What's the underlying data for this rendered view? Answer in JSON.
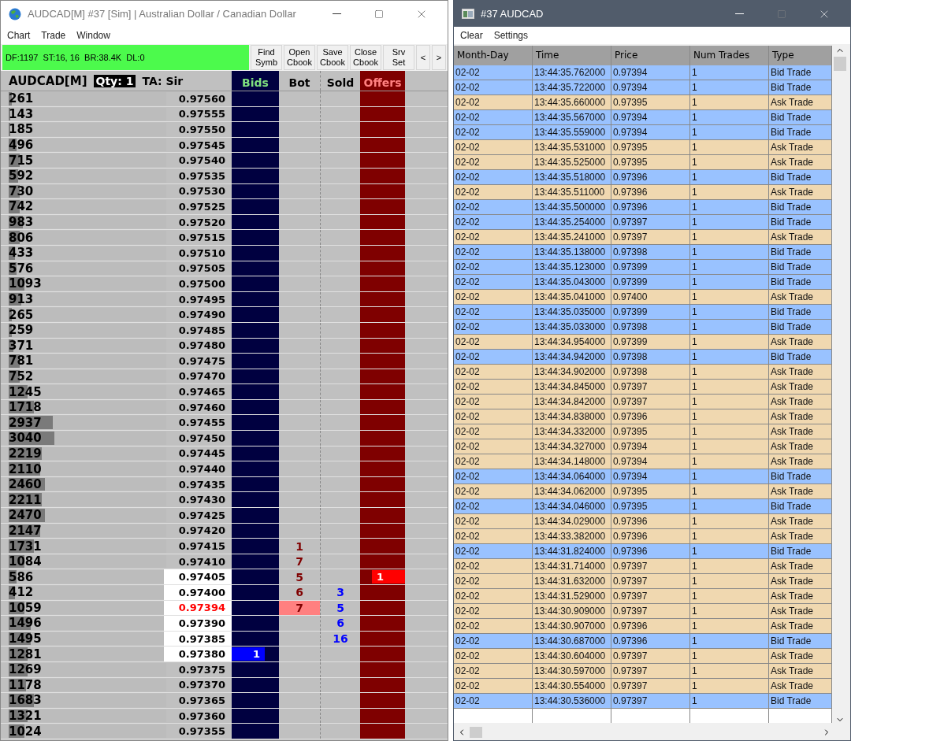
{
  "dom_window": {
    "title": "AUDCAD[M]  #37 [Sim]  | Australian Dollar / Canadian Dollar",
    "menu": [
      "Chart",
      "Trade",
      "Window"
    ],
    "status": "DF:1197  ST:16, 16  BR:38.4K  DL:0",
    "buttons": [
      {
        "lines": [
          "Find",
          "Symb"
        ]
      },
      {
        "lines": [
          "Open",
          "Cbook"
        ]
      },
      {
        "lines": [
          "Save",
          "Cbook"
        ]
      },
      {
        "lines": [
          "Close",
          "Cbook"
        ]
      },
      {
        "lines": [
          "Srv",
          "Set"
        ]
      }
    ],
    "nav_buttons": [
      "<",
      ">"
    ],
    "symbol": "AUDCAD[M]",
    "qty": "Qty: 1",
    "ta": "TA: Sir",
    "columns": {
      "bids": "Bids",
      "bot": "Bot",
      "sold": "Sold",
      "offers": "Offers"
    },
    "rows": [
      {
        "volume": "261",
        "price": "0.97560",
        "level": 0.02
      },
      {
        "volume": "143",
        "price": "0.97555",
        "level": 0.01
      },
      {
        "volume": "185",
        "price": "0.97550",
        "level": 0.01
      },
      {
        "volume": "496",
        "price": "0.97545",
        "level": 0.05
      },
      {
        "volume": "715",
        "price": "0.97540",
        "level": 0.07
      },
      {
        "volume": "592",
        "price": "0.97535",
        "level": 0.06
      },
      {
        "volume": "730",
        "price": "0.97530",
        "level": 0.07
      },
      {
        "volume": "742",
        "price": "0.97525",
        "level": 0.07
      },
      {
        "volume": "983",
        "price": "0.97520",
        "level": 0.09
      },
      {
        "volume": "806",
        "price": "0.97515",
        "level": 0.07
      },
      {
        "volume": "433",
        "price": "0.97510",
        "level": 0.04
      },
      {
        "volume": "576",
        "price": "0.97505",
        "level": 0.05
      },
      {
        "volume": "1093",
        "price": "0.97500",
        "level": 0.1
      },
      {
        "volume": "913",
        "price": "0.97495",
        "level": 0.08
      },
      {
        "volume": "265",
        "price": "0.97490",
        "level": 0.02
      },
      {
        "volume": "259",
        "price": "0.97485",
        "level": 0.02
      },
      {
        "volume": "371",
        "price": "0.97480",
        "level": 0.03
      },
      {
        "volume": "781",
        "price": "0.97475",
        "level": 0.07
      },
      {
        "volume": "752",
        "price": "0.97470",
        "level": 0.07
      },
      {
        "volume": "1245",
        "price": "0.97465",
        "level": 0.12
      },
      {
        "volume": "1718",
        "price": "0.97460",
        "level": 0.16
      },
      {
        "volume": "2937",
        "price": "0.97455",
        "level": 0.28
      },
      {
        "volume": "3040",
        "price": "0.97450",
        "level": 0.29
      },
      {
        "volume": "2219",
        "price": "0.97445",
        "level": 0.21
      },
      {
        "volume": "2110",
        "price": "0.97440",
        "level": 0.2
      },
      {
        "volume": "2460",
        "price": "0.97435",
        "level": 0.23
      },
      {
        "volume": "2211",
        "price": "0.97430",
        "level": 0.21
      },
      {
        "volume": "2470",
        "price": "0.97425",
        "level": 0.23
      },
      {
        "volume": "2147",
        "price": "0.97420",
        "level": 0.2
      },
      {
        "volume": "1731",
        "price": "0.97415",
        "level": 0.16,
        "bot": "1"
      },
      {
        "volume": "1084",
        "price": "0.97410",
        "level": 0.1,
        "bot": "7"
      },
      {
        "volume": "586",
        "price": "0.97405",
        "level": 0.05,
        "bot": "5",
        "price_highlight": true,
        "offer_order": "1"
      },
      {
        "volume": "412",
        "price": "0.97400",
        "level": 0.04,
        "bot": "6",
        "sold": "3",
        "price_highlight": true
      },
      {
        "volume": "1059",
        "price": "0.97394",
        "level": 0.1,
        "bot": "7",
        "bot_highlight": true,
        "sold": "5",
        "price_highlight": true,
        "last": true
      },
      {
        "volume": "1496",
        "price": "0.97390",
        "level": 0.14,
        "sold": "6",
        "price_highlight": true
      },
      {
        "volume": "1495",
        "price": "0.97385",
        "level": 0.14,
        "sold": "16",
        "price_highlight": true
      },
      {
        "volume": "1281",
        "price": "0.97380",
        "level": 0.12,
        "price_highlight": true,
        "bid_order": "1"
      },
      {
        "volume": "1269",
        "price": "0.97375",
        "level": 0.12
      },
      {
        "volume": "1178",
        "price": "0.97370",
        "level": 0.11
      },
      {
        "volume": "1683",
        "price": "0.97365",
        "level": 0.16
      },
      {
        "volume": "1321",
        "price": "0.97360",
        "level": 0.12
      },
      {
        "volume": "1024",
        "price": "0.97355",
        "level": 0.1
      }
    ]
  },
  "tape_window": {
    "title": "#37 AUDCAD",
    "menu": [
      "Clear",
      "Settings"
    ],
    "columns": [
      "Month-Day",
      "Time",
      "Price",
      "Num Trades",
      "Type"
    ],
    "rows": [
      {
        "kind": "bid",
        "date": "02-02",
        "time": "13:44:35.762000",
        "price": "0.97394",
        "trades": "1",
        "type": "Bid Trade"
      },
      {
        "kind": "bid",
        "date": "02-02",
        "time": "13:44:35.722000",
        "price": "0.97394",
        "trades": "1",
        "type": "Bid Trade"
      },
      {
        "kind": "ask",
        "date": "02-02",
        "time": "13:44:35.660000",
        "price": "0.97395",
        "trades": "1",
        "type": "Ask Trade"
      },
      {
        "kind": "bid",
        "date": "02-02",
        "time": "13:44:35.567000",
        "price": "0.97394",
        "trades": "1",
        "type": "Bid Trade"
      },
      {
        "kind": "bid",
        "date": "02-02",
        "time": "13:44:35.559000",
        "price": "0.97394",
        "trades": "1",
        "type": "Bid Trade"
      },
      {
        "kind": "ask",
        "date": "02-02",
        "time": "13:44:35.531000",
        "price": "0.97395",
        "trades": "1",
        "type": "Ask Trade"
      },
      {
        "kind": "ask",
        "date": "02-02",
        "time": "13:44:35.525000",
        "price": "0.97395",
        "trades": "1",
        "type": "Ask Trade"
      },
      {
        "kind": "bid",
        "date": "02-02",
        "time": "13:44:35.518000",
        "price": "0.97396",
        "trades": "1",
        "type": "Bid Trade"
      },
      {
        "kind": "ask",
        "date": "02-02",
        "time": "13:44:35.511000",
        "price": "0.97396",
        "trades": "1",
        "type": "Ask Trade"
      },
      {
        "kind": "bid",
        "date": "02-02",
        "time": "13:44:35.500000",
        "price": "0.97396",
        "trades": "1",
        "type": "Bid Trade"
      },
      {
        "kind": "bid",
        "date": "02-02",
        "time": "13:44:35.254000",
        "price": "0.97397",
        "trades": "1",
        "type": "Bid Trade"
      },
      {
        "kind": "ask",
        "date": "02-02",
        "time": "13:44:35.241000",
        "price": "0.97397",
        "trades": "1",
        "type": "Ask Trade"
      },
      {
        "kind": "bid",
        "date": "02-02",
        "time": "13:44:35.138000",
        "price": "0.97398",
        "trades": "1",
        "type": "Bid Trade"
      },
      {
        "kind": "bid",
        "date": "02-02",
        "time": "13:44:35.123000",
        "price": "0.97399",
        "trades": "1",
        "type": "Bid Trade"
      },
      {
        "kind": "bid",
        "date": "02-02",
        "time": "13:44:35.043000",
        "price": "0.97399",
        "trades": "1",
        "type": "Bid Trade"
      },
      {
        "kind": "ask",
        "date": "02-02",
        "time": "13:44:35.041000",
        "price": "0.97400",
        "trades": "1",
        "type": "Ask Trade"
      },
      {
        "kind": "bid",
        "date": "02-02",
        "time": "13:44:35.035000",
        "price": "0.97399",
        "trades": "1",
        "type": "Bid Trade"
      },
      {
        "kind": "bid",
        "date": "02-02",
        "time": "13:44:35.033000",
        "price": "0.97398",
        "trades": "1",
        "type": "Bid Trade"
      },
      {
        "kind": "ask",
        "date": "02-02",
        "time": "13:44:34.954000",
        "price": "0.97399",
        "trades": "1",
        "type": "Ask Trade"
      },
      {
        "kind": "bid",
        "date": "02-02",
        "time": "13:44:34.942000",
        "price": "0.97398",
        "trades": "1",
        "type": "Bid Trade"
      },
      {
        "kind": "ask",
        "date": "02-02",
        "time": "13:44:34.902000",
        "price": "0.97398",
        "trades": "1",
        "type": "Ask Trade"
      },
      {
        "kind": "ask",
        "date": "02-02",
        "time": "13:44:34.845000",
        "price": "0.97397",
        "trades": "1",
        "type": "Ask Trade"
      },
      {
        "kind": "ask",
        "date": "02-02",
        "time": "13:44:34.842000",
        "price": "0.97397",
        "trades": "1",
        "type": "Ask Trade"
      },
      {
        "kind": "ask",
        "date": "02-02",
        "time": "13:44:34.838000",
        "price": "0.97396",
        "trades": "1",
        "type": "Ask Trade"
      },
      {
        "kind": "ask",
        "date": "02-02",
        "time": "13:44:34.332000",
        "price": "0.97395",
        "trades": "1",
        "type": "Ask Trade"
      },
      {
        "kind": "ask",
        "date": "02-02",
        "time": "13:44:34.327000",
        "price": "0.97394",
        "trades": "1",
        "type": "Ask Trade"
      },
      {
        "kind": "ask",
        "date": "02-02",
        "time": "13:44:34.148000",
        "price": "0.97394",
        "trades": "1",
        "type": "Ask Trade"
      },
      {
        "kind": "bid",
        "date": "02-02",
        "time": "13:44:34.064000",
        "price": "0.97394",
        "trades": "1",
        "type": "Bid Trade"
      },
      {
        "kind": "ask",
        "date": "02-02",
        "time": "13:44:34.062000",
        "price": "0.97395",
        "trades": "1",
        "type": "Ask Trade"
      },
      {
        "kind": "bid",
        "date": "02-02",
        "time": "13:44:34.046000",
        "price": "0.97395",
        "trades": "1",
        "type": "Bid Trade"
      },
      {
        "kind": "ask",
        "date": "02-02",
        "time": "13:44:34.029000",
        "price": "0.97396",
        "trades": "1",
        "type": "Ask Trade"
      },
      {
        "kind": "ask",
        "date": "02-02",
        "time": "13:44:33.382000",
        "price": "0.97396",
        "trades": "1",
        "type": "Ask Trade"
      },
      {
        "kind": "bid",
        "date": "02-02",
        "time": "13:44:31.824000",
        "price": "0.97396",
        "trades": "1",
        "type": "Bid Trade"
      },
      {
        "kind": "ask",
        "date": "02-02",
        "time": "13:44:31.714000",
        "price": "0.97397",
        "trades": "1",
        "type": "Ask Trade"
      },
      {
        "kind": "ask",
        "date": "02-02",
        "time": "13:44:31.632000",
        "price": "0.97397",
        "trades": "1",
        "type": "Ask Trade"
      },
      {
        "kind": "ask",
        "date": "02-02",
        "time": "13:44:31.529000",
        "price": "0.97397",
        "trades": "1",
        "type": "Ask Trade"
      },
      {
        "kind": "ask",
        "date": "02-02",
        "time": "13:44:30.909000",
        "price": "0.97397",
        "trades": "1",
        "type": "Ask Trade"
      },
      {
        "kind": "ask",
        "date": "02-02",
        "time": "13:44:30.907000",
        "price": "0.97396",
        "trades": "1",
        "type": "Ask Trade"
      },
      {
        "kind": "bid",
        "date": "02-02",
        "time": "13:44:30.687000",
        "price": "0.97396",
        "trades": "1",
        "type": "Bid Trade"
      },
      {
        "kind": "ask",
        "date": "02-02",
        "time": "13:44:30.604000",
        "price": "0.97397",
        "trades": "1",
        "type": "Ask Trade"
      },
      {
        "kind": "ask",
        "date": "02-02",
        "time": "13:44:30.597000",
        "price": "0.97397",
        "trades": "1",
        "type": "Ask Trade"
      },
      {
        "kind": "ask",
        "date": "02-02",
        "time": "13:44:30.554000",
        "price": "0.97397",
        "trades": "1",
        "type": "Ask Trade"
      },
      {
        "kind": "bid",
        "date": "02-02",
        "time": "13:44:30.536000",
        "price": "0.97397",
        "trades": "1",
        "type": "Bid Trade"
      }
    ]
  }
}
